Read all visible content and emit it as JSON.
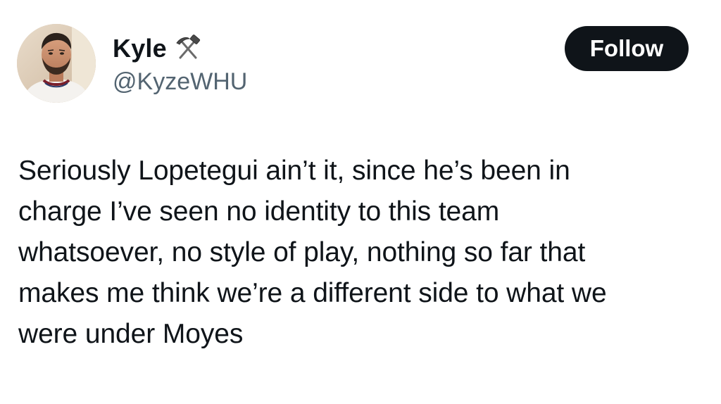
{
  "author": {
    "display_name": "Kyle",
    "handle": "@KyzeWHU",
    "name_emoji": "hammer-and-pick-icon",
    "avatar": "profile-photo"
  },
  "actions": {
    "follow_label": "Follow"
  },
  "tweet": {
    "lines": [
      "Seriously Lopetegui ain’t it, since he’s been in",
      "charge I’ve seen no identity to this team",
      "whatsoever, no style of play, nothing so far that",
      "makes me think we’re a different side to what we",
      "were under Moyes"
    ]
  },
  "colors": {
    "background": "#ffffff",
    "text": "#0f1419",
    "secondary_text": "#536471",
    "button_bg": "#0f1419",
    "button_text": "#ffffff"
  }
}
